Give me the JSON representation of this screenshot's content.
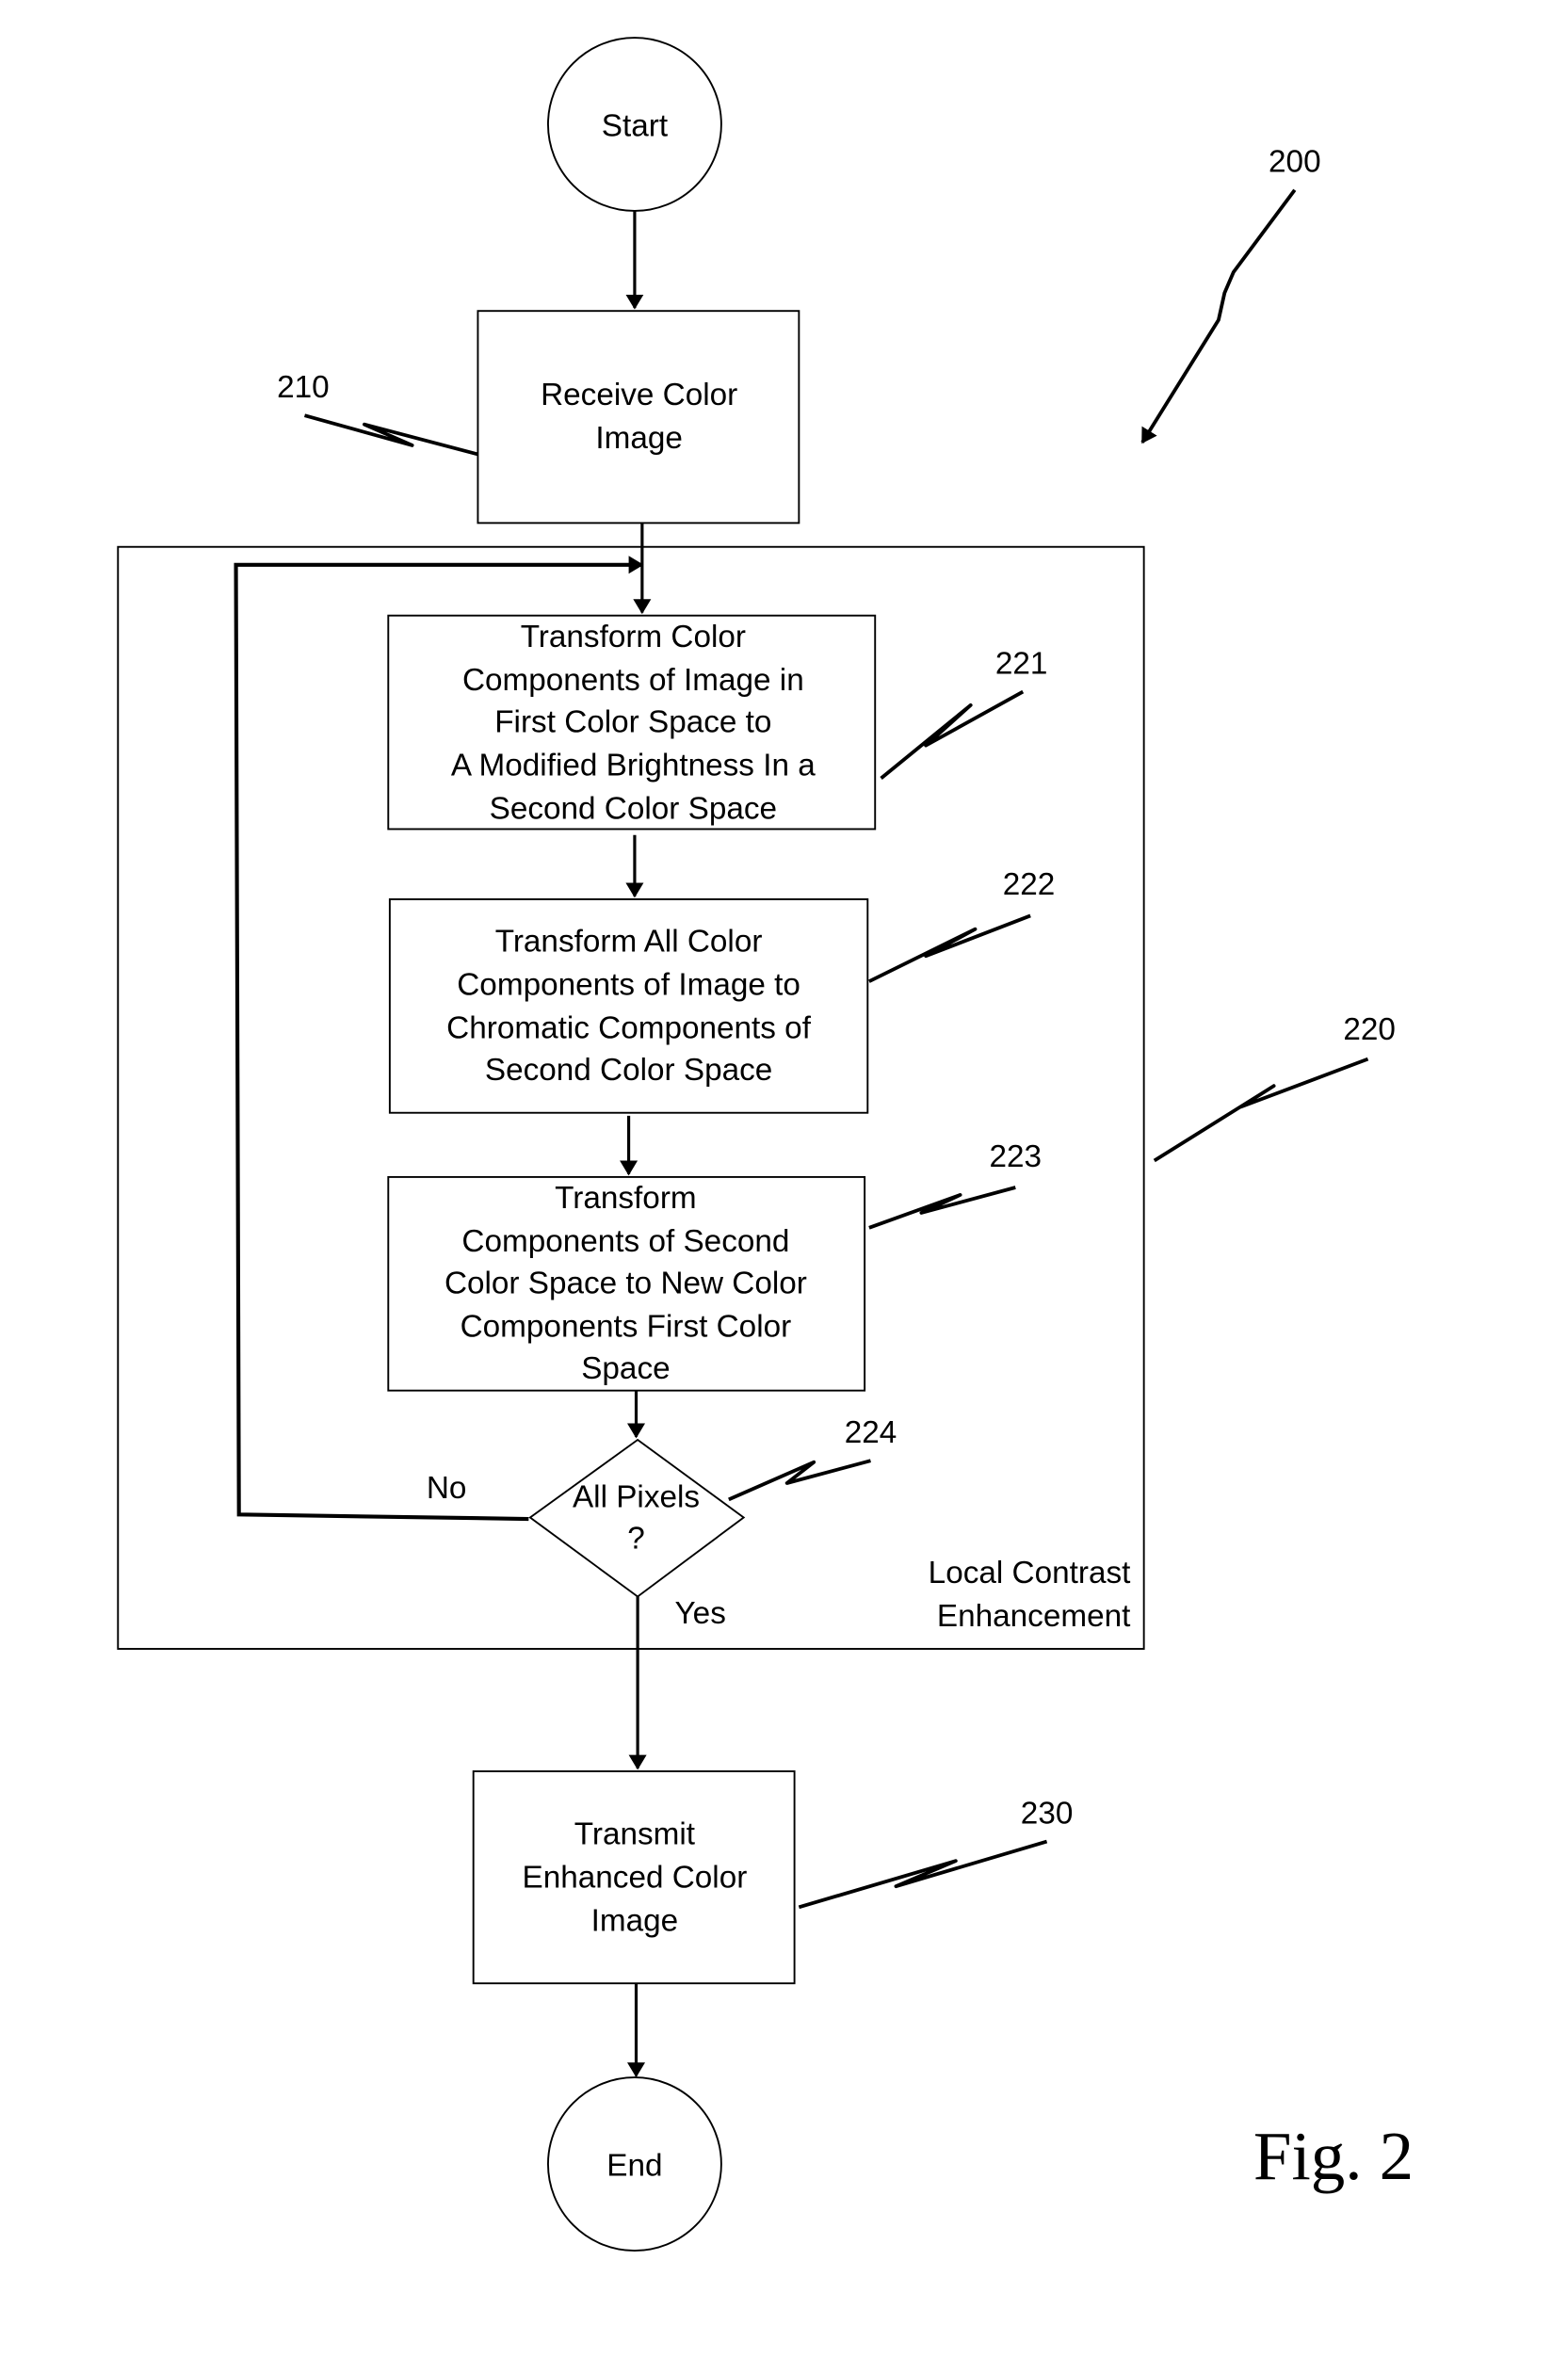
{
  "figure": {
    "title": "Fig. 2",
    "reference": "200"
  },
  "nodes": {
    "start": {
      "label": "Start"
    },
    "step_210": {
      "ref": "210",
      "lines": [
        "Receive Color",
        "Image"
      ]
    },
    "group_220": {
      "ref": "220",
      "lines": [
        "Local Contrast",
        "Enhancement"
      ]
    },
    "step_221": {
      "ref": "221",
      "lines": [
        "Transform Color",
        "Components of Image in",
        "First Color Space  to",
        "A Modified Brightness In a",
        "Second Color Space"
      ]
    },
    "step_222": {
      "ref": "222",
      "lines": [
        "Transform All  Color",
        "Components of Image to",
        "Chromatic Components of",
        "Second Color Space"
      ]
    },
    "step_223": {
      "ref": "223",
      "lines": [
        "Transform",
        "Components of Second",
        "Color Space to New Color",
        "Components First Color",
        "Space"
      ]
    },
    "decision_224": {
      "ref": "224",
      "lines": [
        "All Pixels",
        "?"
      ],
      "no_label": "No",
      "yes_label": "Yes"
    },
    "step_230": {
      "ref": "230",
      "lines": [
        "Transmit",
        "Enhanced Color",
        "Image"
      ]
    },
    "end": {
      "label": "End"
    }
  },
  "edges": [
    {
      "from": "start",
      "to": "step_210"
    },
    {
      "from": "step_210",
      "to": "step_221"
    },
    {
      "from": "step_221",
      "to": "step_222"
    },
    {
      "from": "step_222",
      "to": "step_223"
    },
    {
      "from": "step_223",
      "to": "decision_224"
    },
    {
      "from": "decision_224",
      "to": "step_221",
      "label": "No"
    },
    {
      "from": "decision_224",
      "to": "step_230",
      "label": "Yes"
    },
    {
      "from": "step_230",
      "to": "end"
    }
  ]
}
